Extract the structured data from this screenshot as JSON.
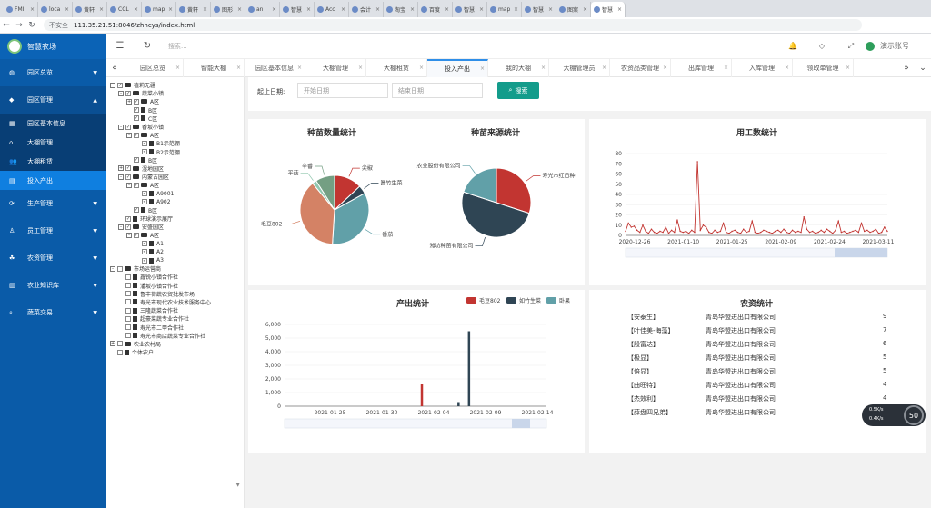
{
  "browser": {
    "tabs": [
      "FMI",
      "loca",
      "黄轩",
      "CCL",
      "map",
      "黄轩",
      "图形",
      "an",
      "智慧",
      "Acc",
      "会计",
      "淘宝",
      "百度",
      "智慧",
      "map",
      "智慧",
      "图案",
      "智慧"
    ],
    "active_tab": 17,
    "security_text": "不安全",
    "url": "111.35.21.51:8046/zhncys/index.html"
  },
  "app": {
    "title": "智慧农场"
  },
  "sidebar": {
    "menus": [
      {
        "label": "园区总览",
        "icon": "globe-icon",
        "open": false
      },
      {
        "label": "园区管理",
        "icon": "tag-icon",
        "open": true
      }
    ],
    "submenus": [
      {
        "label": "园区基本信息",
        "icon": "grid-icon"
      },
      {
        "label": "大棚管理",
        "icon": "home-icon"
      },
      {
        "label": "大棚租赁",
        "icon": "users-icon"
      },
      {
        "label": "投入产出",
        "icon": "doc-icon",
        "active": true
      }
    ],
    "menus2": [
      {
        "label": "生产管理",
        "icon": "cycle-icon"
      },
      {
        "label": "员工管理",
        "icon": "user-icon"
      },
      {
        "label": "农资管理",
        "icon": "leaf-icon"
      },
      {
        "label": "农业知识库",
        "icon": "book-icon"
      },
      {
        "label": "蔬菜交易",
        "icon": "search-icon"
      }
    ]
  },
  "topbar": {
    "search_placeholder": "搜索...",
    "user_name": "演示账号"
  },
  "page_tabs": [
    "园区总览",
    "智能大棚",
    "园区基本信息",
    "大棚管理",
    "大棚租赁",
    "投入产出",
    "我的大棚",
    "大棚管理员",
    "农资品类管理",
    "出库管理",
    "入库管理",
    "领取单管理"
  ],
  "active_page_tab": 5,
  "tree": [
    {
      "d": 0,
      "t": "-",
      "c": "✓",
      "k": "fd",
      "label": "植莉无疆"
    },
    {
      "d": 1,
      "t": "-",
      "c": "✓",
      "k": "fd",
      "label": "蔬菜小镇"
    },
    {
      "d": 2,
      "t": "+",
      "c": "✓",
      "k": "fd",
      "label": "A区"
    },
    {
      "d": 2,
      "t": "",
      "c": "✓",
      "k": "fl",
      "label": "B区"
    },
    {
      "d": 2,
      "t": "",
      "c": "✓",
      "k": "fl",
      "label": "C区"
    },
    {
      "d": 1,
      "t": "-",
      "c": "✓",
      "k": "fd",
      "label": "香坂小镇"
    },
    {
      "d": 2,
      "t": "-",
      "c": "✓",
      "k": "fd",
      "label": "A区"
    },
    {
      "d": 3,
      "t": "",
      "c": "✓",
      "k": "fl",
      "label": "B1示范棚"
    },
    {
      "d": 3,
      "t": "",
      "c": "✓",
      "k": "fl",
      "label": "B2示范棚"
    },
    {
      "d": 2,
      "t": "",
      "c": "✓",
      "k": "fl",
      "label": "B区"
    },
    {
      "d": 1,
      "t": "+",
      "c": "✓",
      "k": "fd",
      "label": "湿地园区"
    },
    {
      "d": 1,
      "t": "-",
      "c": "✓",
      "k": "fd",
      "label": "内蒙古园区"
    },
    {
      "d": 2,
      "t": "-",
      "c": "✓",
      "k": "fd",
      "label": "A区"
    },
    {
      "d": 3,
      "t": "",
      "c": "✓",
      "k": "fl",
      "label": "A9001"
    },
    {
      "d": 3,
      "t": "",
      "c": "✓",
      "k": "fl",
      "label": "A902"
    },
    {
      "d": 2,
      "t": "",
      "c": "✓",
      "k": "fl",
      "label": "B区"
    },
    {
      "d": 1,
      "t": "",
      "c": "✓",
      "k": "fl",
      "label": "环球演示展厅"
    },
    {
      "d": 1,
      "t": "-",
      "c": "✓",
      "k": "fd",
      "label": "安盛园区"
    },
    {
      "d": 2,
      "t": "-",
      "c": "✓",
      "k": "fd",
      "label": "A区"
    },
    {
      "d": 3,
      "t": "",
      "c": "✓",
      "k": "fl",
      "label": "A1"
    },
    {
      "d": 3,
      "t": "",
      "c": "✓",
      "k": "fl",
      "label": "A2"
    },
    {
      "d": 3,
      "t": "",
      "c": "✓",
      "k": "fl",
      "label": "A3"
    },
    {
      "d": 0,
      "t": "-",
      "c": "",
      "k": "fd",
      "label": "市场运营商"
    },
    {
      "d": 1,
      "t": "",
      "c": "",
      "k": "fl",
      "label": "鑫锐小镇合作社"
    },
    {
      "d": 1,
      "t": "",
      "c": "",
      "k": "fl",
      "label": "潘坂小镇合作社"
    },
    {
      "d": 1,
      "t": "",
      "c": "",
      "k": "fl",
      "label": "鲁丰荷蔬农贸批发市场"
    },
    {
      "d": 1,
      "t": "",
      "c": "",
      "k": "fl",
      "label": "寿光市现代农业技术服务中心"
    },
    {
      "d": 1,
      "t": "",
      "c": "",
      "k": "fl",
      "label": "三隆蔬菜合作社"
    },
    {
      "d": 1,
      "t": "",
      "c": "",
      "k": "fl",
      "label": "超豪菜蔬专业合作社"
    },
    {
      "d": 1,
      "t": "",
      "c": "",
      "k": "fl",
      "label": "寿光市二甲合作社"
    },
    {
      "d": 1,
      "t": "",
      "c": "",
      "k": "fl",
      "label": "寿光市商店蔬菜专业合作社"
    },
    {
      "d": 0,
      "t": "+",
      "c": "",
      "k": "fd",
      "label": "农业农村局"
    },
    {
      "d": 0,
      "t": "",
      "c": "",
      "k": "fl",
      "label": "个体农户"
    }
  ],
  "filter": {
    "label": "起止日期:",
    "start_placeholder": "开始日期",
    "end_placeholder": "结束日期",
    "search_label": "搜索"
  },
  "seedling_count": {
    "title": "种苗数量统计",
    "chart_data": {
      "type": "pie",
      "labels": [
        "尖椒",
        "圆竹生菜",
        "番茄",
        "毛豆802",
        "平菇",
        "辛番"
      ],
      "values": [
        13,
        4,
        34,
        38,
        2,
        9
      ],
      "colors": [
        "#c23531",
        "#2f4554",
        "#61a0a8",
        "#d48265",
        "#91c7ae",
        "#749f83"
      ]
    }
  },
  "seedling_source": {
    "title": "种苗来源统计",
    "chart_data": {
      "type": "pie",
      "labels": [
        "寿光市红日种",
        "潍坊种苗有限公司",
        "XX农业股份有限公司"
      ],
      "values": [
        30,
        50,
        20
      ],
      "colors": [
        "#c23531",
        "#2f4554",
        "#61a0a8"
      ]
    }
  },
  "labor": {
    "title": "用工数统计",
    "chart_data": {
      "type": "line",
      "x_ticks": [
        "2020-12-26",
        "2021-01-10",
        "2021-01-25",
        "2021-02-09",
        "2021-02-24",
        "2021-03-11"
      ],
      "y_ticks": [
        "0",
        "10",
        "20",
        "30",
        "40",
        "50",
        "60",
        "70",
        "80"
      ],
      "ylim": [
        0,
        80
      ],
      "values": [
        4,
        12,
        8,
        9,
        5,
        3,
        10,
        4,
        2,
        6,
        3,
        2,
        4,
        3,
        8,
        2,
        5,
        3,
        15,
        4,
        3,
        4,
        2,
        5,
        3,
        72,
        5,
        10,
        8,
        3,
        2,
        5,
        3,
        4,
        12,
        3,
        2,
        4,
        5,
        3,
        2,
        6,
        3,
        4,
        14,
        3,
        2,
        3,
        5,
        4,
        3,
        2,
        4,
        5,
        3,
        6,
        3,
        2,
        5,
        3,
        4,
        3,
        18,
        6,
        3,
        4,
        2,
        3,
        5,
        3,
        6,
        4,
        2,
        5,
        14,
        3,
        4,
        2,
        3,
        4,
        5,
        3,
        12,
        4,
        5,
        3,
        4,
        6,
        2,
        3,
        8,
        4
      ]
    }
  },
  "output": {
    "title": "产出统计",
    "legend": [
      "毛豆802",
      "如竹生菜",
      "卧果"
    ],
    "chart_data": {
      "type": "bar",
      "x_ticks": [
        "2021-01-25",
        "2021-01-30",
        "2021-02-04",
        "2021-02-09",
        "2021-02-14"
      ],
      "y_ticks": [
        "0",
        "1,000",
        "2,000",
        "3,000",
        "4,000",
        "5,000",
        "6,000"
      ],
      "ylim": [
        0,
        6000
      ],
      "series": [
        {
          "name": "毛豆802",
          "color": "#c23531",
          "points": [
            [
              0.52,
              1600
            ]
          ]
        },
        {
          "name": "如竹生菜",
          "color": "#2f4554",
          "points": [
            [
              0.66,
              300
            ],
            [
              0.7,
              5500
            ]
          ]
        },
        {
          "name": "卧果",
          "color": "#61a0a8",
          "points": []
        }
      ]
    }
  },
  "farm": {
    "title": "农资统计",
    "rows": [
      {
        "name": "【安泰生】",
        "company": "青岛华盟进出口有限公司",
        "count": "9"
      },
      {
        "name": "【叶佳美-海藻】",
        "company": "青岛华盟进出口有限公司",
        "count": "7"
      },
      {
        "name": "【殷富达】",
        "company": "青岛华盟进出口有限公司",
        "count": "6"
      },
      {
        "name": "【极显】",
        "company": "青岛华盟进出口有限公司",
        "count": "5"
      },
      {
        "name": "【倍显】",
        "company": "青岛华盟进出口有限公司",
        "count": "5"
      },
      {
        "name": "【曲旺特】",
        "company": "青岛华盟进出口有限公司",
        "count": "4"
      },
      {
        "name": "【杰效利】",
        "company": "青岛华盟进出口有限公司",
        "count": "4"
      },
      {
        "name": "【薛盘四兄弟】",
        "company": "青岛华盟进出口有限公司",
        "count": "4"
      }
    ]
  },
  "gauge": {
    "value": "50",
    "up": "0.5K/s",
    "down": "0.4K/s"
  }
}
